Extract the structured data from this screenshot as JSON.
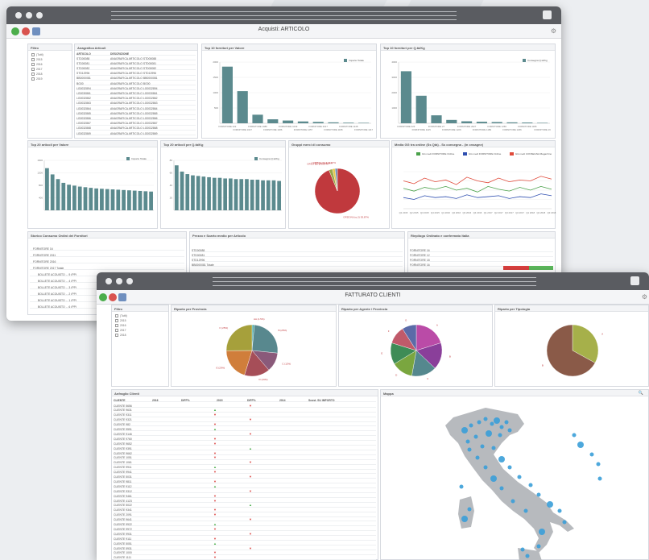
{
  "window1": {
    "title": "Acquisti: ARTICOLO",
    "filter_title": "Filtro",
    "filter_items": [
      "(Tutti)",
      "2015",
      "2016",
      "2017",
      "2018",
      "2019"
    ],
    "articles": {
      "title": "Anagrafica Articoli",
      "columns": [
        "ARTICOLO",
        "DESCRIZIONE"
      ],
      "rows": [
        [
          "STD00088",
          "ANAGRAFICA ARTICOLO STD00088"
        ],
        [
          "STD00081",
          "ANAGRAFICA ARTICOLO STD00081"
        ],
        [
          "STD00082",
          "ANAGRAFICA ARTICOLO STD00082"
        ],
        [
          "STD12996",
          "ANAGRAFICA ARTICOLO STD12996"
        ],
        [
          "BB0000081",
          "ANAGRAFICA ARTICOLO BB0000081"
        ],
        [
          "BG00",
          "ANAGRAFICA ARTICOLO BG00"
        ],
        [
          "LG0032894",
          "ANAGRAFICA ARTICOLO LG0032894"
        ],
        [
          "LG0030861",
          "ANAGRAFICA ARTICOLO LG0030861"
        ],
        [
          "LG0032862",
          "ANAGRAFICA ARTICOLO LG0032862"
        ],
        [
          "LG0032863",
          "ANAGRAFICA ARTICOLO LG0032863"
        ],
        [
          "LG0032864",
          "ANAGRAFICA ARTICOLO LG0032864"
        ],
        [
          "LG0032865",
          "ANAGRAFICA ARTICOLO LG0032865"
        ],
        [
          "LG0032866",
          "ANAGRAFICA ARTICOLO LG0032866"
        ],
        [
          "LG0032867",
          "ANAGRAFICA ARTICOLO LG0032867"
        ],
        [
          "LG0032868",
          "ANAGRAFICA ARTICOLO LG0032868"
        ],
        [
          "LG0032869",
          "ANAGRAFICA ARTICOLO LG0032869"
        ]
      ]
    },
    "top_fornitori_valore": "Top 10 fornitori per Valore",
    "top_fornitori_quantita": "Top 10 fornitori per Q.tà/Kg",
    "top_articoli_valore": "Top 20 articoli per Valore",
    "top_articoli_quantita": "Top 20 articoli per Q.tà/Kg",
    "gruppi": "Gruppi merci di consumo",
    "trend": "Media GG tra ordine (Ss Qtà) - Ss consegna - (in cnsagne)",
    "bottom_left": "Storico Consumo Ordini dei Fornitori",
    "bottom_mid": "Prezzo e Scarto medio per Articolo",
    "bottom_right": "Riepilogo Ordinato e confermato Italia",
    "bottom_rows": [
      "FORNITORE 16",
      "FORNITORE 2011",
      "FORNITORE 2016",
      "FORNITORE 2017 Totale",
      "BOLLETE ACQUISTO ... 9 (PP)",
      "BOLLETE ACQUISTO ... 4 (PP)",
      "BOLLETE ACQUISTO ... 3 (PP)",
      "BOLLETE ACQUISTO ... 2 (PP)",
      "BOLLETE ACQUISTO ... 1 (PP)",
      "BOLLETE ACQUISTO ... 6 (PP)"
    ],
    "price_rows": [
      "STD00088",
      "STD00081",
      "STD12996",
      "BB0000081 Totale"
    ],
    "conf_rows": [
      "FORNITORE 16",
      "FORNITORE 12",
      "FORNITORE 18",
      "FORNITORE 16"
    ]
  },
  "window2": {
    "title": "FATTURATO CLIENTI",
    "filter_title": "Filtro",
    "filter_items": [
      "(Tutti)",
      "2015",
      "2016",
      "2017",
      "2018"
    ],
    "pie1_title": "Riparto per Provincia",
    "pie2_title": "Riparto per Agente / Provincia",
    "pie3_title": "Riparto per Tipologia",
    "table_title": "Anfraglio Clienti",
    "table_columns": [
      "CLIENTE",
      "2016",
      "DIFF%",
      "2015",
      "DIFF%",
      "2014",
      "Scost. SU IMPORTO"
    ],
    "clients": [
      "CLIENTE 5656",
      "CLIENTE 9631",
      "CLIENTE 9311",
      "CLIENTE 9321",
      "CLIENTE 982",
      "CLIENTE 9591",
      "CLIENTE 9146",
      "CLIENTE 9760",
      "CLIENTE 9652",
      "CLIENTE 9391",
      "CLIENTE 9662",
      "CLIENTE 1051",
      "CLIENTE 1061",
      "CLIENTE 9911",
      "CLIENTE 9941",
      "CLIENTE 5031",
      "CLIENTE 9811",
      "CLIENTE 9112",
      "CLIENTE 9312",
      "CLIENTE 9461",
      "CLIENTE 4123",
      "CLIENTE 5022",
      "CLIENTE 9341",
      "CLIENTE 2091",
      "CLIENTE 9641",
      "CLIENTE 9922",
      "CLIENTE 9972",
      "CLIENTE 9931",
      "CLIENTE 9111",
      "CLIENTE 5051",
      "CLIENTE 5931",
      "CLIENTE 1000",
      "CLIENTE 1111"
    ],
    "map_title": "Mappa"
  },
  "chart_data": [
    {
      "type": "bar",
      "title": "Top 10 fornitori per Valore",
      "series": [
        {
          "name": "Importo Totale",
          "values": [
            1850,
            1050,
            280,
            130,
            90,
            60,
            45,
            30,
            20,
            15
          ]
        }
      ],
      "categories": [
        "FORNITORE 222",
        "FORNITORE 1027",
        "FORNITORE 1089",
        "FORNITORE 1186",
        "FORNITORE 1049",
        "FORNITORE 1257",
        "FORNITORE 2017",
        "FORNITORE 1195",
        "FORNITORE 1148",
        "FORNITORE 1117"
      ],
      "ylim": [
        0,
        2000
      ],
      "color": "#5b8a8e"
    },
    {
      "type": "bar",
      "title": "Top 10 fornitori per Q.tà/Kg",
      "series": [
        {
          "name": "Consegna Q.tà/Kg",
          "values": [
            3400,
            1800,
            520,
            220,
            130,
            100,
            80,
            60,
            50,
            30
          ]
        }
      ],
      "categories": [
        "FORNITORE 323",
        "FORNITORE 1125",
        "FORNITORE 27",
        "FORNITORE 1229",
        "FORNITORE 2027",
        "FORNITORE 1189",
        "FORNITORE 1266",
        "FORNITORE 1266",
        "FORNITORE 1186",
        "FORNITORE 16"
      ],
      "ylim": [
        0,
        4000
      ],
      "color": "#5b8a8e"
    },
    {
      "type": "bar",
      "title": "Top 20 articoli per Valore",
      "series": [
        {
          "name": "Importo Totale",
          "values": [
            1350,
            1150,
            1000,
            880,
            820,
            790,
            760,
            740,
            720,
            700,
            690,
            680,
            670,
            660,
            650,
            640,
            630,
            620,
            610,
            600
          ]
        }
      ],
      "ylim": [
        0,
        1600
      ],
      "color": "#5b8a8e"
    },
    {
      "type": "bar",
      "title": "Top 20 articoli per Q.tà/Kg",
      "series": [
        {
          "name": "Consegna Q.tà/Kg",
          "values": [
            72,
            62,
            58,
            56,
            55,
            54,
            53,
            52,
            52,
            51,
            51,
            50,
            50,
            50,
            49,
            49,
            48,
            48,
            48,
            47
          ]
        }
      ],
      "ylim": [
        0,
        80
      ],
      "color": "#5b8a8e"
    },
    {
      "type": "pie",
      "title": "Gruppi merci di consumo",
      "categories": [
        "OPZIONI (sc.2) 93,87%",
        "OPZ 2 (sc.1) 2,57%",
        "OPZ 1 (sc.3) 1,89%",
        "OPZ 3 (sc.1) 1,67%"
      ],
      "values": [
        93.87,
        2.57,
        1.89,
        1.67
      ],
      "colors": [
        "#c0393d",
        "#9aa94a",
        "#e8c84e",
        "#6d8bb0"
      ]
    },
    {
      "type": "line",
      "title": "Media GG tra ordine (Ss Qtà) - Ss consegna - (in cnsagne)",
      "x": [
        "Q1 2015",
        "Q2 2015",
        "Q3 2015",
        "Q4 2015",
        "Q1 2016",
        "Q2 2016",
        "Q3 2016",
        "Q4 2016",
        "Q1 2017",
        "Q2 2017",
        "Q3 2017",
        "Q4 2017",
        "Q1 2018",
        "Q2 2018",
        "Q3 2018"
      ],
      "series": [
        {
          "name": "GG medi FORNITORE Ordine",
          "color": "#4aa14a",
          "values": [
            22,
            19,
            23,
            21,
            24,
            20,
            22,
            18,
            24,
            21,
            19,
            23,
            20,
            24,
            21
          ]
        },
        {
          "name": "GG medi FORNITORE Ordine",
          "color": "#2f4fb0",
          "values": [
            12,
            10,
            14,
            12,
            13,
            11,
            15,
            12,
            13,
            14,
            11,
            13,
            12,
            16,
            14
          ]
        },
        {
          "name": "GG medi CONSEGNA Magazzino",
          "color": "#e04a3a",
          "values": [
            30,
            27,
            33,
            29,
            31,
            26,
            34,
            30,
            28,
            33,
            29,
            31,
            30,
            35,
            32
          ]
        }
      ]
    },
    {
      "type": "pie",
      "title": "Riparto per Provincia",
      "categories": [
        "AA (1.5%)",
        "B (25%)",
        "C (12%)",
        "D (16%)",
        "E (20%)",
        "F (25%)"
      ],
      "values": [
        1.5,
        25,
        12,
        16,
        20,
        25
      ],
      "colors": [
        "#4fa9a6",
        "#58888e",
        "#8a5a7a",
        "#a64e58",
        "#d07e3b",
        "#a6a03b"
      ]
    },
    {
      "type": "pie",
      "title": "Riparto per Agente / Provincia",
      "categories": [
        "A",
        "B",
        "C",
        "D",
        "E",
        "F",
        "G"
      ],
      "values": [
        18,
        15,
        14,
        12,
        12,
        10,
        8
      ],
      "colors": [
        "#ba4ba7",
        "#8a3f9a",
        "#55888e",
        "#7aa63f",
        "#3e8c56",
        "#c05a6a",
        "#5b6ba8"
      ]
    },
    {
      "type": "pie",
      "title": "Riparto per Tipologia",
      "categories": [
        "A",
        "B"
      ],
      "values": [
        33,
        67
      ],
      "colors": [
        "#a6b04a",
        "#8a5a48"
      ]
    }
  ]
}
